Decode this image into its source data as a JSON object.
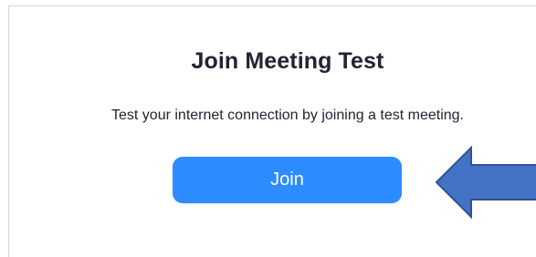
{
  "join_meeting_test": {
    "title": "Join Meeting Test",
    "description": "Test your internet connection by joining a test meeting.",
    "join_label": "Join"
  },
  "annotation": {
    "arrow_direction": "left",
    "arrow_fill": "#4472c4",
    "arrow_stroke": "#2f528f"
  },
  "colors": {
    "accent": "#2d8cff",
    "text": "#232333",
    "border": "#d6d6d6"
  }
}
